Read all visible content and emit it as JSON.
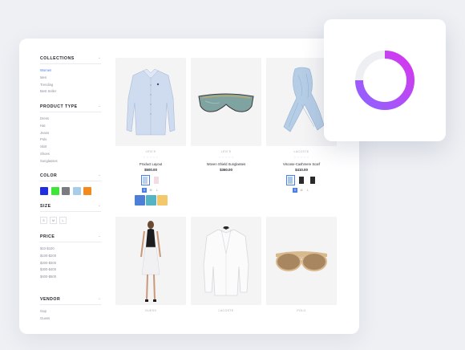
{
  "sidebar": {
    "collections": {
      "title": "COLLECTIONS",
      "items": [
        "Women",
        "Men",
        "Trending",
        "Best Seller"
      ],
      "active_index": 0
    },
    "product_type": {
      "title": "PRODUCT TYPE",
      "items": [
        "Dress",
        "Hat",
        "Jeans",
        "Polo",
        "Skirt",
        "Shoes",
        "Sunglasses"
      ]
    },
    "color": {
      "title": "COLOR",
      "swatches": [
        "#1f2fe0",
        "#3ee63a",
        "#7b7b82",
        "#a6cdea",
        "#f28a1e"
      ]
    },
    "size": {
      "title": "SIZE",
      "options": [
        "S",
        "M",
        "L"
      ]
    },
    "price": {
      "title": "PRICE",
      "ranges": [
        "$10-$100",
        "$100-$200",
        "$200-$300",
        "$300-$400",
        "$400-$500"
      ]
    },
    "vendor": {
      "title": "VENDOR",
      "items": [
        "Gap",
        "Guess"
      ]
    }
  },
  "products": [
    {
      "vendor": "LEVI'S",
      "stars": "☆☆☆☆☆",
      "name": "Product Layout",
      "price": "$500.00",
      "image": "shirt-photo",
      "variant_colors": [
        "#bcd0ea",
        "#f2dbe4"
      ],
      "variant_sizes": [
        "S",
        "M",
        "L"
      ],
      "pattern_chips": [
        "#4d7fd6",
        "#54b4c4",
        "#f2c86a"
      ]
    },
    {
      "vendor": "LEVI'S",
      "stars": "☆☆☆☆☆",
      "name": "Woven Shield Sunglasses",
      "price": "$360.00",
      "image": "sunglasses-photo"
    },
    {
      "vendor": "LACOSTE",
      "stars": "☆☆☆☆☆",
      "name": "Viscose-Cashmere Scarf",
      "price": "$410.00",
      "image": "scarf-photo",
      "variant_colors": [
        "#a9c7e6",
        "#2a2a2c",
        "#2a2a2c"
      ],
      "variant_sizes": [
        "S",
        "M",
        "L"
      ]
    },
    {
      "vendor": "GUESS",
      "image": "dress-model-photo"
    },
    {
      "vendor": "LACOSTE",
      "image": "blazer-photo"
    },
    {
      "vendor": "POLO",
      "image": "round-sunglasses-photo"
    }
  ],
  "widget": {
    "icon": "progress-ring-icon",
    "gradient": [
      "#d637ee",
      "#8f63ff"
    ]
  }
}
